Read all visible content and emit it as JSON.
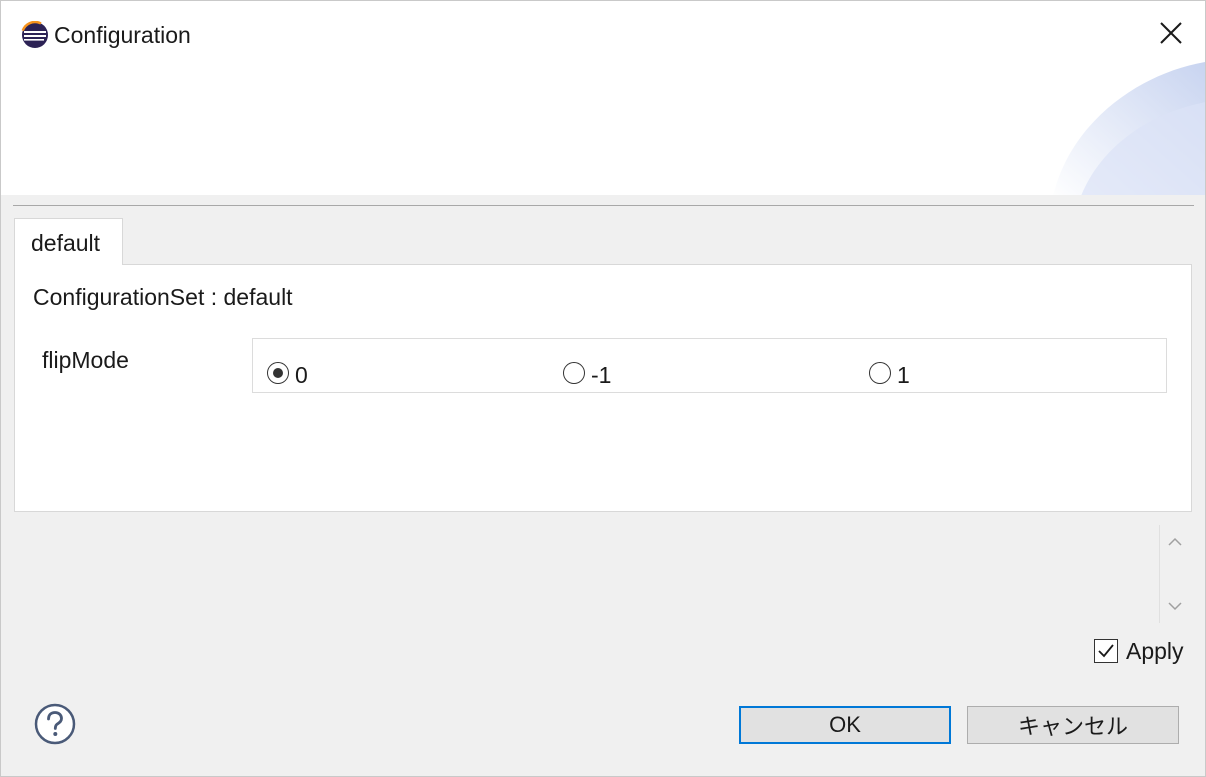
{
  "window": {
    "title": "Configuration",
    "icon": "eclipse-icon",
    "close_icon": "close-icon"
  },
  "tabs": [
    {
      "label": "default",
      "active": true
    }
  ],
  "panel": {
    "config_set_label": "ConfigurationSet :",
    "config_set_value": "default",
    "parameter": {
      "name": "flipMode",
      "options": [
        {
          "label": "0",
          "checked": true
        },
        {
          "label": "-1",
          "checked": false
        },
        {
          "label": "1",
          "checked": false
        }
      ]
    }
  },
  "apply": {
    "label": "Apply",
    "checked": true
  },
  "buttons": {
    "ok_label": "OK",
    "cancel_label": "キャンセル"
  },
  "colors": {
    "focus_border": "#0078d7",
    "banner_accent": "#c9d6f2"
  }
}
